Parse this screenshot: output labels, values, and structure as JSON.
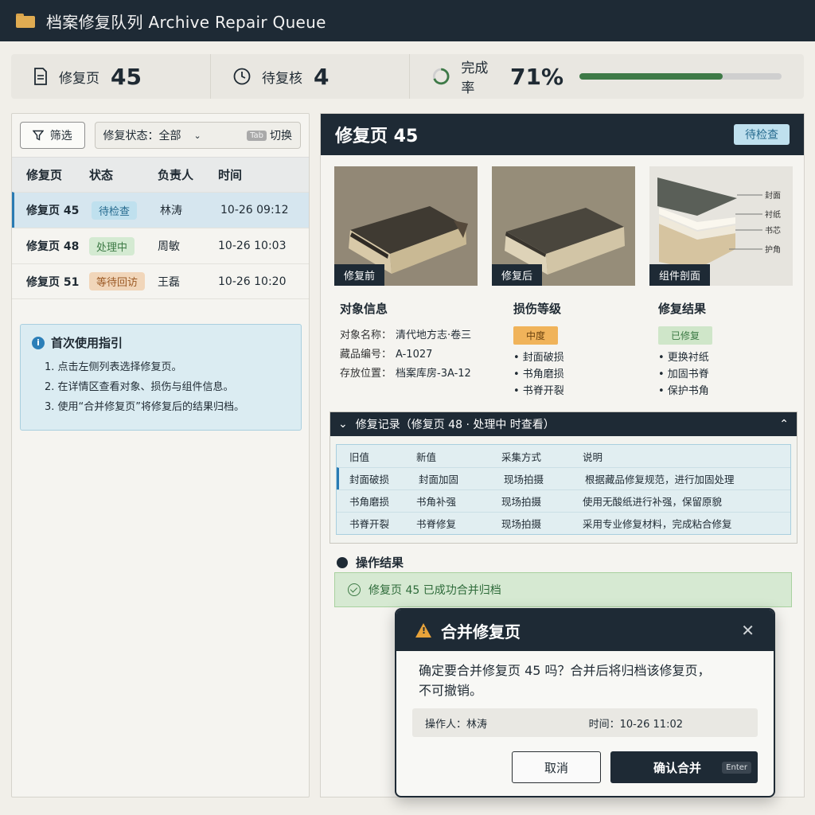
{
  "app": {
    "title": "档案修复队列 Archive Repair Queue"
  },
  "stats": {
    "pages_label": "修复页",
    "pages_value": "45",
    "review_label": "待复核",
    "review_value": "4",
    "rate_label": "完成率",
    "rate_value": "71%",
    "rate_fraction": 0.71,
    "accent": "#3e7a47"
  },
  "left": {
    "filter_label": "筛选",
    "status_filter": "修复状态：全部",
    "tab_key": "Tab",
    "tab_text": "切换",
    "columns": [
      "修复页",
      "状态",
      "负责人",
      "时间"
    ],
    "rows": [
      {
        "page": "修复页 45",
        "status": "待检查",
        "owner": "林涛",
        "time": "10-26 09:12"
      },
      {
        "page": "修复页 48",
        "status": "处理中",
        "owner": "周敏",
        "time": "10-26 10:03"
      },
      {
        "page": "修复页 51",
        "status": "等待回访",
        "owner": "王磊",
        "time": "10-26 10:20"
      }
    ],
    "guide": {
      "title": "首次使用指引",
      "steps": [
        "1. 点击左侧列表选择修复页。",
        "2. 在详情区查看对象、损伤与组件信息。",
        "3. 使用“合并修复页”将修复后的结果归档。"
      ]
    }
  },
  "detail": {
    "title": "修复页 45",
    "status": "待检查",
    "photos": [
      "修复前",
      "修复后",
      "组件剖面"
    ],
    "section_labels": [
      "封面",
      "衬纸",
      "书芯",
      "护角"
    ],
    "object_info": {
      "title": "对象信息",
      "name_key": "对象名称：",
      "name_val": "清代地方志·卷三",
      "id_key": "藏品编号：",
      "id_val": "A-1027",
      "loc_key": "存放位置：",
      "loc_val": "档案库房-3A-12"
    },
    "damage": {
      "title": "损伤等级",
      "level": "中度",
      "items": [
        "• 封面破损",
        "• 书角磨损",
        "• 书脊开裂"
      ]
    },
    "result": {
      "title": "修复结果",
      "level": "已修复",
      "items": [
        "• 更换衬纸",
        "• 加固书脊",
        "• 保护书角"
      ]
    },
    "records": {
      "header": "修复记录（修复页 48 · 处理中 时查看）",
      "columns": [
        "旧值",
        "新值",
        "采集方式",
        "说明"
      ],
      "rows": [
        [
          "封面破损",
          "封面加固",
          "现场拍摄",
          "根据藏品修复规范，进行加固处理"
        ],
        [
          "书角磨损",
          "书角补强",
          "现场拍摄",
          "使用无酸纸进行补强，保留原貌"
        ],
        [
          "书脊开裂",
          "书脊修复",
          "现场拍摄",
          "采用专业修复材料，完成粘合修复"
        ]
      ]
    },
    "op_title": "操作结果",
    "op_result": "修复页 45 已成功合并归档"
  },
  "dialog": {
    "title": "合并修复页",
    "message1": "确定要合并修复页 45 吗？合并后将归档该修复页，",
    "message2": "不可撤销。",
    "operator": "操作人：林涛",
    "time": "时间：10-26 11:02",
    "cancel": "取消",
    "confirm": "确认合并",
    "confirm_key": "Enter"
  }
}
